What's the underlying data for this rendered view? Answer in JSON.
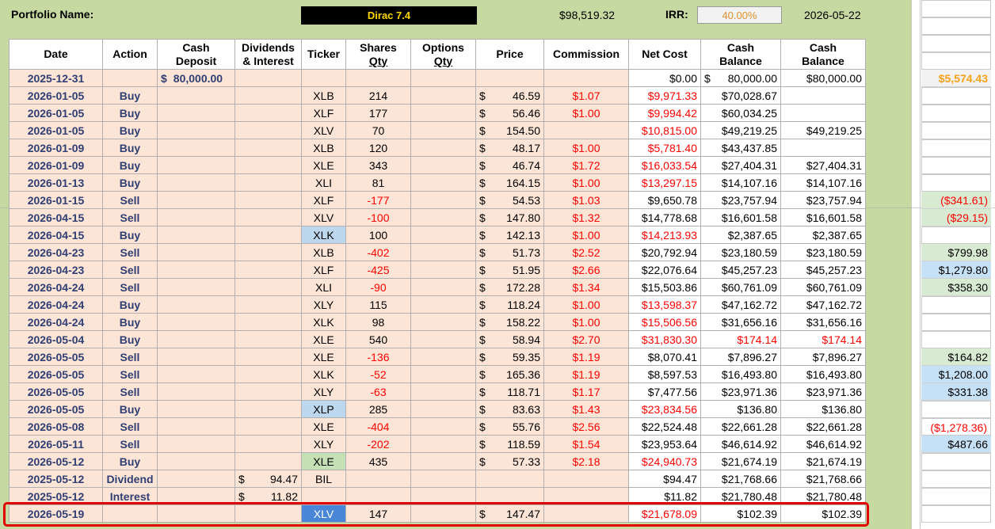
{
  "header": {
    "portfolio_label": "Portfolio Name:",
    "portfolio_name": "Dirac 7.4",
    "total_value": "$98,519.32",
    "irr_label": "IRR:",
    "irr_value": "40.00%",
    "date": "2026-05-22"
  },
  "columns": [
    {
      "line1": "Date",
      "line2": ""
    },
    {
      "line1": "Action",
      "line2": ""
    },
    {
      "line1": "Cash",
      "line2": "Deposit"
    },
    {
      "line1": "Dividends",
      "line2": "& Interest"
    },
    {
      "line1": "Ticker",
      "line2": ""
    },
    {
      "line1": "Shares",
      "line2": "Qty"
    },
    {
      "line1": "Options",
      "line2": "Qty"
    },
    {
      "line1": "Price",
      "line2": ""
    },
    {
      "line1": "Commission",
      "line2": ""
    },
    {
      "line1": "Net Cost",
      "line2": ""
    },
    {
      "line1": "Cash",
      "line2": "Balance"
    },
    {
      "line1": "Cash",
      "line2": "Balance"
    }
  ],
  "rows": [
    {
      "date": "2025-12-31",
      "action": "",
      "deposit": "80,000.00",
      "divint": "",
      "ticker": "",
      "ticker_style": "",
      "shares": "",
      "price": "",
      "commission": "",
      "net_cost": "$0.00",
      "net_neg": false,
      "bal1_sym": "$",
      "bal1": "80,000.00",
      "bal1_neg": false,
      "bal2": "$80,000.00",
      "bal2_neg": false,
      "side": "$5,574.43",
      "side_style": "first"
    },
    {
      "date": "2026-01-05",
      "action": "Buy",
      "deposit": "",
      "divint": "",
      "ticker": "XLB",
      "ticker_style": "",
      "shares": "214",
      "price": "46.59",
      "commission": "$1.07",
      "net_cost": "$9,971.33",
      "net_neg": true,
      "bal1_sym": "",
      "bal1": "$70,028.67",
      "bal1_neg": false,
      "bal2": "",
      "bal2_neg": false,
      "side": "",
      "side_style": "empty"
    },
    {
      "date": "2026-01-05",
      "action": "Buy",
      "deposit": "",
      "divint": "",
      "ticker": "XLF",
      "ticker_style": "",
      "shares": "177",
      "price": "56.46",
      "commission": "$1.00",
      "net_cost": "$9,994.42",
      "net_neg": true,
      "bal1_sym": "",
      "bal1": "$60,034.25",
      "bal1_neg": false,
      "bal2": "",
      "bal2_neg": false,
      "side": "",
      "side_style": "empty"
    },
    {
      "date": "2026-01-05",
      "action": "Buy",
      "deposit": "",
      "divint": "",
      "ticker": "XLV",
      "ticker_style": "",
      "shares": "70",
      "price": "154.50",
      "commission": "",
      "net_cost": "$10,815.00",
      "net_neg": true,
      "bal1_sym": "",
      "bal1": "$49,219.25",
      "bal1_neg": false,
      "bal2": "$49,219.25",
      "bal2_neg": false,
      "side": "",
      "side_style": "empty"
    },
    {
      "date": "2026-01-09",
      "action": "Buy",
      "deposit": "",
      "divint": "",
      "ticker": "XLB",
      "ticker_style": "",
      "shares": "120",
      "price": "48.17",
      "commission": "$1.00",
      "net_cost": "$5,781.40",
      "net_neg": true,
      "bal1_sym": "",
      "bal1": "$43,437.85",
      "bal1_neg": false,
      "bal2": "",
      "bal2_neg": false,
      "side": "",
      "side_style": "empty"
    },
    {
      "date": "2026-01-09",
      "action": "Buy",
      "deposit": "",
      "divint": "",
      "ticker": "XLE",
      "ticker_style": "",
      "shares": "343",
      "price": "46.74",
      "commission": "$1.72",
      "net_cost": "$16,033.54",
      "net_neg": true,
      "bal1_sym": "",
      "bal1": "$27,404.31",
      "bal1_neg": false,
      "bal2": "$27,404.31",
      "bal2_neg": false,
      "side": "",
      "side_style": "empty"
    },
    {
      "date": "2026-01-13",
      "action": "Buy",
      "deposit": "",
      "divint": "",
      "ticker": "XLI",
      "ticker_style": "",
      "shares": "81",
      "price": "164.15",
      "commission": "$1.00",
      "net_cost": "$13,297.15",
      "net_neg": true,
      "bal1_sym": "",
      "bal1": "$14,107.16",
      "bal1_neg": false,
      "bal2": "$14,107.16",
      "bal2_neg": false,
      "side": "",
      "side_style": "empty"
    },
    {
      "date": "2026-01-15",
      "action": "Sell",
      "deposit": "",
      "divint": "",
      "ticker": "XLF",
      "ticker_style": "",
      "shares": "-177",
      "price": "54.53",
      "commission": "$1.03",
      "net_cost": "$9,650.78",
      "net_neg": false,
      "bal1_sym": "",
      "bal1": "$23,757.94",
      "bal1_neg": false,
      "bal2": "$23,757.94",
      "bal2_neg": false,
      "side": "($341.61)",
      "side_style": "green-neg"
    },
    {
      "date": "2026-04-15",
      "action": "Sell",
      "deposit": "",
      "divint": "",
      "ticker": "XLV",
      "ticker_style": "",
      "shares": "-100",
      "price": "147.80",
      "commission": "$1.32",
      "net_cost": "$14,778.68",
      "net_neg": false,
      "bal1_sym": "",
      "bal1": "$16,601.58",
      "bal1_neg": false,
      "bal2": "$16,601.58",
      "bal2_neg": false,
      "side": "($29.15)",
      "side_style": "green-neg"
    },
    {
      "date": "2026-04-15",
      "action": "Buy",
      "deposit": "",
      "divint": "",
      "ticker": "XLK",
      "ticker_style": "lblue",
      "shares": "100",
      "price": "142.13",
      "commission": "$1.00",
      "net_cost": "$14,213.93",
      "net_neg": true,
      "bal1_sym": "",
      "bal1": "$2,387.65",
      "bal1_neg": false,
      "bal2": "$2,387.65",
      "bal2_neg": false,
      "side": "",
      "side_style": "empty"
    },
    {
      "date": "2026-04-23",
      "action": "Sell",
      "deposit": "",
      "divint": "",
      "ticker": "XLB",
      "ticker_style": "",
      "shares": "-402",
      "price": "51.73",
      "commission": "$2.52",
      "net_cost": "$20,792.94",
      "net_neg": false,
      "bal1_sym": "",
      "bal1": "$23,180.59",
      "bal1_neg": false,
      "bal2": "$23,180.59",
      "bal2_neg": false,
      "side": "$799.98",
      "side_style": "green"
    },
    {
      "date": "2026-04-23",
      "action": "Sell",
      "deposit": "",
      "divint": "",
      "ticker": "XLF",
      "ticker_style": "",
      "shares": "-425",
      "price": "51.95",
      "commission": "$2.66",
      "net_cost": "$22,076.64",
      "net_neg": false,
      "bal1_sym": "",
      "bal1": "$45,257.23",
      "bal1_neg": false,
      "bal2": "$45,257.23",
      "bal2_neg": false,
      "side": "$1,279.80",
      "side_style": "blue"
    },
    {
      "date": "2026-04-24",
      "action": "Sell",
      "deposit": "",
      "divint": "",
      "ticker": "XLI",
      "ticker_style": "",
      "shares": "-90",
      "price": "172.28",
      "commission": "$1.34",
      "net_cost": "$15,503.86",
      "net_neg": false,
      "bal1_sym": "",
      "bal1": "$60,761.09",
      "bal1_neg": false,
      "bal2": "$60,761.09",
      "bal2_neg": false,
      "side": "$358.30",
      "side_style": "green"
    },
    {
      "date": "2026-04-24",
      "action": "Buy",
      "deposit": "",
      "divint": "",
      "ticker": "XLY",
      "ticker_style": "",
      "shares": "115",
      "price": "118.24",
      "commission": "$1.00",
      "net_cost": "$13,598.37",
      "net_neg": true,
      "bal1_sym": "",
      "bal1": "$47,162.72",
      "bal1_neg": false,
      "bal2": "$47,162.72",
      "bal2_neg": false,
      "side": "",
      "side_style": "empty"
    },
    {
      "date": "2026-04-24",
      "action": "Buy",
      "deposit": "",
      "divint": "",
      "ticker": "XLK",
      "ticker_style": "",
      "shares": "98",
      "price": "158.22",
      "commission": "$1.00",
      "net_cost": "$15,506.56",
      "net_neg": true,
      "bal1_sym": "",
      "bal1": "$31,656.16",
      "bal1_neg": false,
      "bal2": "$31,656.16",
      "bal2_neg": false,
      "side": "",
      "side_style": "empty"
    },
    {
      "date": "2026-05-04",
      "action": "Buy",
      "deposit": "",
      "divint": "",
      "ticker": "XLE",
      "ticker_style": "",
      "shares": "540",
      "price": "58.94",
      "commission": "$2.70",
      "net_cost": "$31,830.30",
      "net_neg": true,
      "bal1_sym": "",
      "bal1": "$174.14",
      "bal1_neg": true,
      "bal2": "$174.14",
      "bal2_neg": true,
      "side": "",
      "side_style": "empty"
    },
    {
      "date": "2026-05-05",
      "action": "Sell",
      "deposit": "",
      "divint": "",
      "ticker": "XLE",
      "ticker_style": "",
      "shares": "-136",
      "price": "59.35",
      "commission": "$1.19",
      "net_cost": "$8,070.41",
      "net_neg": false,
      "bal1_sym": "",
      "bal1": "$7,896.27",
      "bal1_neg": false,
      "bal2": "$7,896.27",
      "bal2_neg": false,
      "side": "$164.82",
      "side_style": "green"
    },
    {
      "date": "2026-05-05",
      "action": "Sell",
      "deposit": "",
      "divint": "",
      "ticker": "XLK",
      "ticker_style": "",
      "shares": "-52",
      "price": "165.36",
      "commission": "$1.19",
      "net_cost": "$8,597.53",
      "net_neg": false,
      "bal1_sym": "",
      "bal1": "$16,493.80",
      "bal1_neg": false,
      "bal2": "$16,493.80",
      "bal2_neg": false,
      "side": "$1,208.00",
      "side_style": "blue"
    },
    {
      "date": "2026-05-05",
      "action": "Sell",
      "deposit": "",
      "divint": "",
      "ticker": "XLY",
      "ticker_style": "",
      "shares": "-63",
      "price": "118.71",
      "commission": "$1.17",
      "net_cost": "$7,477.56",
      "net_neg": false,
      "bal1_sym": "",
      "bal1": "$23,971.36",
      "bal1_neg": false,
      "bal2": "$23,971.36",
      "bal2_neg": false,
      "side": "$331.38",
      "side_style": "blue"
    },
    {
      "date": "2026-05-05",
      "action": "Buy",
      "deposit": "",
      "divint": "",
      "ticker": "XLP",
      "ticker_style": "lblue",
      "shares": "285",
      "price": "83.63",
      "commission": "$1.43",
      "net_cost": "$23,834.56",
      "net_neg": true,
      "bal1_sym": "",
      "bal1": "$136.80",
      "bal1_neg": false,
      "bal2": "$136.80",
      "bal2_neg": false,
      "side": "",
      "side_style": "empty"
    },
    {
      "date": "2026-05-08",
      "action": "Sell",
      "deposit": "",
      "divint": "",
      "ticker": "XLE",
      "ticker_style": "",
      "shares": "-404",
      "price": "55.76",
      "commission": "$2.56",
      "net_cost": "$22,524.48",
      "net_neg": false,
      "bal1_sym": "",
      "bal1": "$22,661.28",
      "bal1_neg": false,
      "bal2": "$22,661.28",
      "bal2_neg": false,
      "side": "($1,278.36)",
      "side_style": "empty-neg"
    },
    {
      "date": "2026-05-11",
      "action": "Sell",
      "deposit": "",
      "divint": "",
      "ticker": "XLY",
      "ticker_style": "",
      "shares": "-202",
      "price": "118.59",
      "commission": "$1.54",
      "net_cost": "$23,953.64",
      "net_neg": false,
      "bal1_sym": "",
      "bal1": "$46,614.92",
      "bal1_neg": false,
      "bal2": "$46,614.92",
      "bal2_neg": false,
      "side": "$487.66",
      "side_style": "blue"
    },
    {
      "date": "2026-05-12",
      "action": "Buy",
      "deposit": "",
      "divint": "",
      "ticker": "XLE",
      "ticker_style": "green",
      "shares": "435",
      "price": "57.33",
      "commission": "$2.18",
      "net_cost": "$24,940.73",
      "net_neg": true,
      "bal1_sym": "",
      "bal1": "$21,674.19",
      "bal1_neg": false,
      "bal2": "$21,674.19",
      "bal2_neg": false,
      "side": "",
      "side_style": "empty"
    },
    {
      "date": "2025-05-12",
      "action": "Dividend",
      "deposit": "",
      "divint": "94.47",
      "ticker": "BIL",
      "ticker_style": "",
      "shares": "",
      "price": "",
      "commission": "",
      "net_cost": "$94.47",
      "net_neg": false,
      "bal1_sym": "",
      "bal1": "$21,768.66",
      "bal1_neg": false,
      "bal2": "$21,768.66",
      "bal2_neg": false,
      "side": "",
      "side_style": "empty"
    },
    {
      "date": "2025-05-12",
      "action": "Interest",
      "deposit": "",
      "divint": "11.82",
      "ticker": "",
      "ticker_style": "",
      "shares": "",
      "price": "",
      "commission": "",
      "net_cost": "$11.82",
      "net_neg": false,
      "bal1_sym": "",
      "bal1": "$21,780.48",
      "bal1_neg": false,
      "bal2": "$21,780.48",
      "bal2_neg": false,
      "side": "",
      "side_style": "empty"
    },
    {
      "date": "2026-05-19",
      "action": "",
      "deposit": "",
      "divint": "",
      "ticker": "XLV",
      "ticker_style": "blue",
      "shares": "147",
      "price": "147.47",
      "commission": "",
      "net_cost": "$21,678.09",
      "net_neg": true,
      "bal1_sym": "",
      "bal1": "$102.39",
      "bal1_neg": false,
      "bal2": "$102.39",
      "bal2_neg": false,
      "side": "",
      "side_style": "empty"
    }
  ],
  "colors": {
    "sheet_green": "#c5d9a0",
    "row_peach": "#fce4d6",
    "negative": "#ff0000",
    "date_text": "#2f3f73",
    "highlight_border": "#e00000",
    "portfolio_name_text": "#ffd700",
    "irr_text": "#e0912b"
  }
}
